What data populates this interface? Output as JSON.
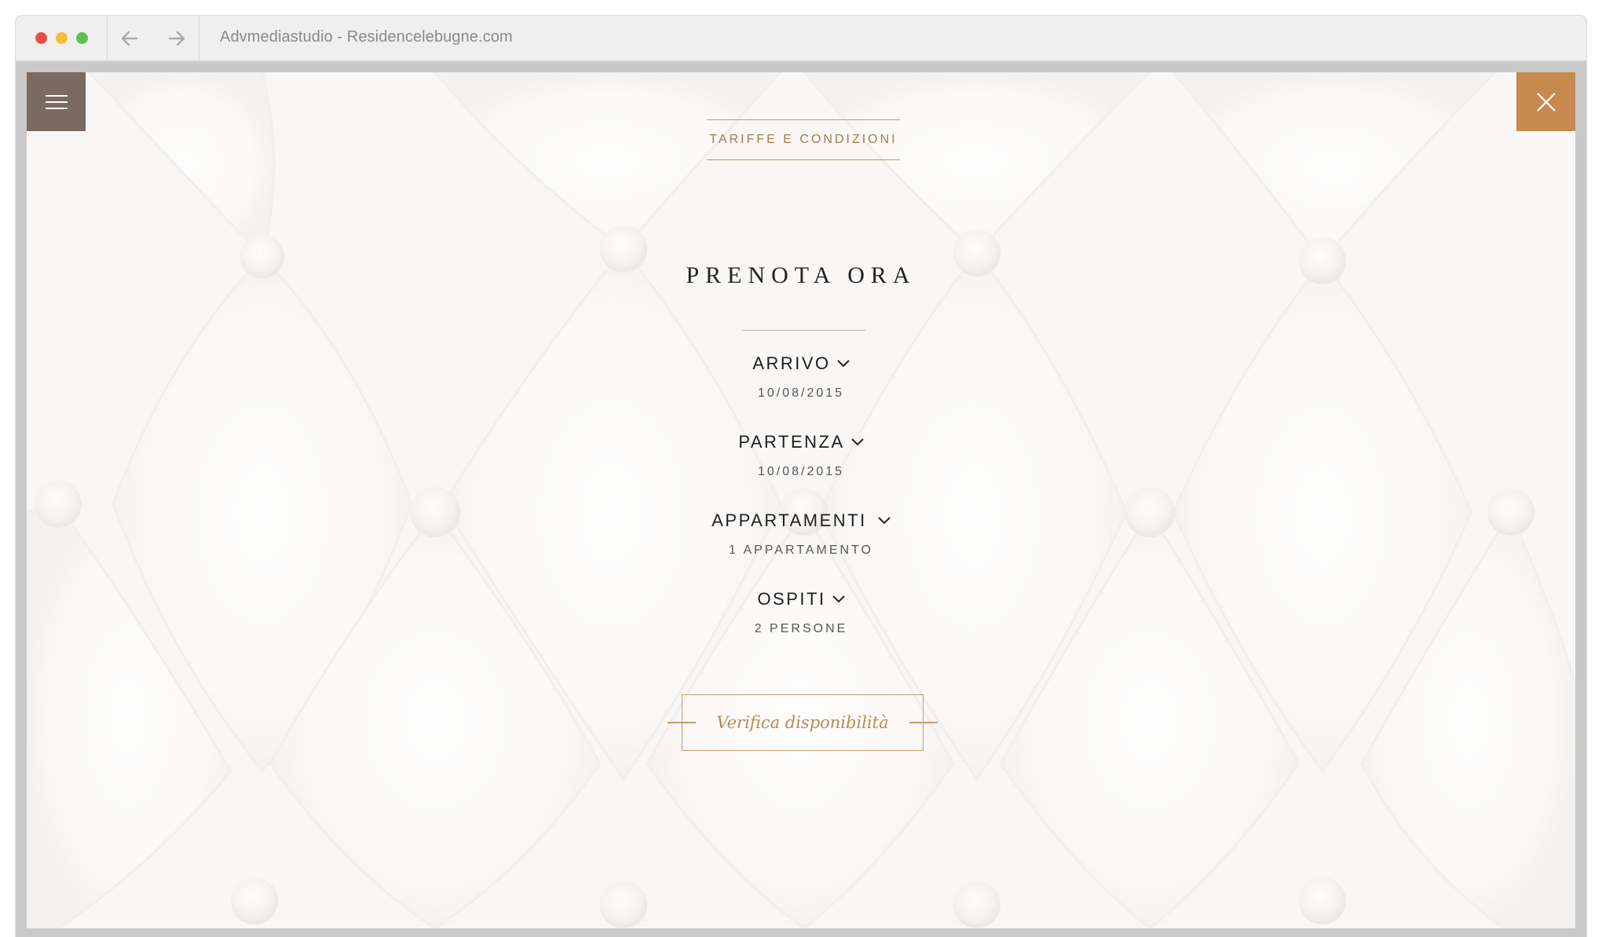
{
  "browser": {
    "address": "Advmediastudio - Residencelebugne.com"
  },
  "page": {
    "tariffe_link": "TARIFFE E CONDIZIONI",
    "title": "PRENOTA ORA",
    "fields": [
      {
        "label": "ARRIVO",
        "value": "10/08/2015"
      },
      {
        "label": "PARTENZA",
        "value": "10/08/2015"
      },
      {
        "label": "APPARTAMENTI",
        "value": "1 APPARTAMENTO"
      },
      {
        "label": "OSPITI",
        "value": "2 PERSONE"
      }
    ],
    "cta_label": "Verifica disponibilità"
  },
  "colors": {
    "menu_button": "#7a6a5f",
    "close_button": "#c8894f",
    "accent_gold": "#c39a6c",
    "background": "#f6f5f3"
  },
  "icons": {
    "menu": "hamburger-icon",
    "close": "close-icon",
    "back": "arrow-left-icon",
    "forward": "arrow-right-icon",
    "dropdown": "chevron-down-icon"
  }
}
